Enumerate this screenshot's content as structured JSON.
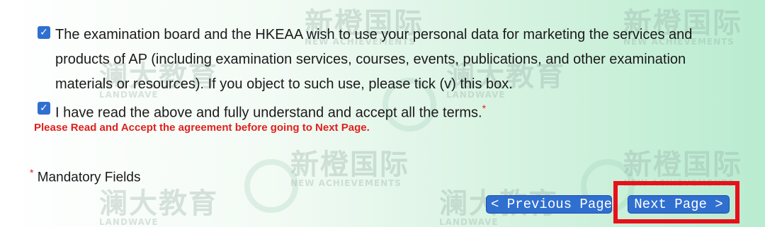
{
  "terms": {
    "marketing_text": "The examination board and the HKEAA wish to use your personal data for marketing the services and products of AP (including examination services, courses, events, publications, and other examination materials or resources). If you object to such use, please tick (v) this box.",
    "marketing_checked": true,
    "accept_text": "I have read the above and fully understand and accept all the terms.",
    "accept_checked": true,
    "required_mark": "*",
    "warning": "Please Read and Accept the agreement before going to Next Page."
  },
  "mandatory": {
    "mark": "*",
    "label": "Mandatory Fields"
  },
  "nav": {
    "prev_label": "< Previous Page",
    "next_label": "Next Page >"
  },
  "watermark": {
    "text1": "新橙国际",
    "text1_sub": "NEW ACHIEVEMENTS",
    "text2": "澜大教育",
    "text2_sub": "LANDWAVE"
  },
  "colors": {
    "checkbox": "#2f6fd0",
    "warning": "#e0201d",
    "button": "#2f6fd0",
    "highlight_box": "#e8101a"
  }
}
